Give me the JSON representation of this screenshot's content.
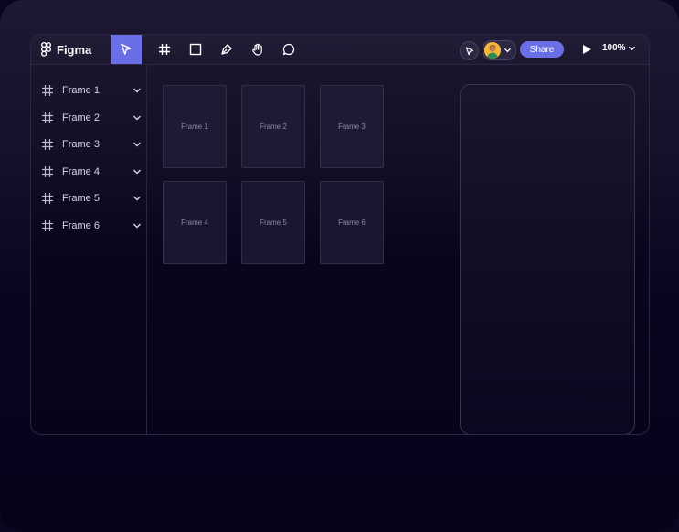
{
  "app": {
    "name": "Figma"
  },
  "toolbar": {
    "tools": [
      {
        "name": "move-tool",
        "icon": "cursor-arrow-icon",
        "active": true
      },
      {
        "name": "frame-tool",
        "icon": "hash-frame-icon",
        "active": false
      },
      {
        "name": "rectangle-tool",
        "icon": "square-icon",
        "active": false
      },
      {
        "name": "pen-tool",
        "icon": "pen-icon",
        "active": false
      },
      {
        "name": "hand-tool",
        "icon": "hand-icon",
        "active": false
      },
      {
        "name": "comment-tool",
        "icon": "speech-bubble-icon",
        "active": false
      }
    ],
    "share_label": "Share",
    "zoom_label": "100%",
    "accent_color": "#6b6fe6"
  },
  "layers": [
    {
      "label": "Frame 1"
    },
    {
      "label": "Frame 2"
    },
    {
      "label": "Frame 3"
    },
    {
      "label": "Frame 4"
    },
    {
      "label": "Frame 5"
    },
    {
      "label": "Frame 6"
    }
  ],
  "canvas": {
    "frames": [
      {
        "label": "Frame 1"
      },
      {
        "label": "Frame 2"
      },
      {
        "label": "Frame 3"
      },
      {
        "label": "Frame 4"
      },
      {
        "label": "Frame 5"
      },
      {
        "label": "Frame 6"
      }
    ]
  }
}
